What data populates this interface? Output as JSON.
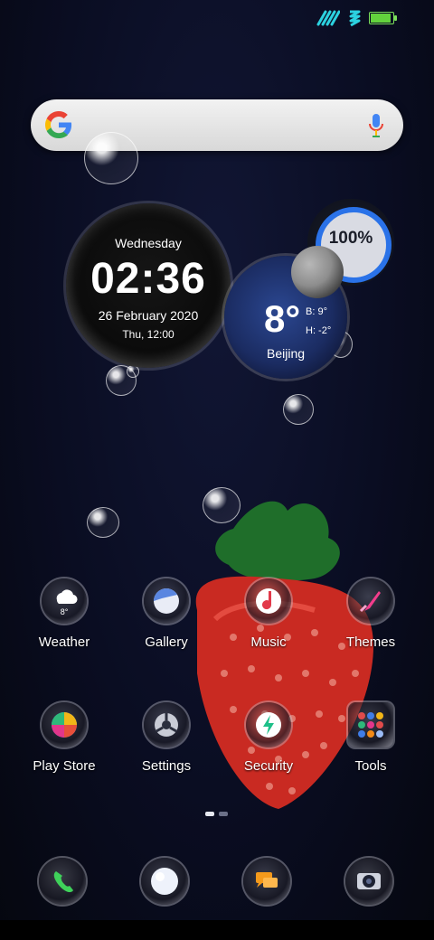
{
  "status_bar": {
    "icons": [
      "signal-icon",
      "network-icon",
      "battery-icon"
    ],
    "battery_level": 1.0,
    "accent_color": "#2cd2e0",
    "battery_color": "#63d33d"
  },
  "search": {
    "logo": "G",
    "icon_left": "google-icon",
    "icon_right": "microphone-icon"
  },
  "clock_widget": {
    "day": "Wednesday",
    "time": "02:36",
    "date": "26 February 2020",
    "alarm": "Thu, 12:00"
  },
  "weather_widget": {
    "temp": "8°",
    "high": "B: 9°",
    "low": "H: -2°",
    "city": "Beijing",
    "icon": "moon-icon"
  },
  "battery_widget": {
    "percent_text": "100%",
    "level": 1.0,
    "ring_color": "#2a72e8"
  },
  "apps": [
    {
      "label": "Weather",
      "icon": "weather-icon",
      "sub": "8°"
    },
    {
      "label": "Gallery",
      "icon": "gallery-icon"
    },
    {
      "label": "Music",
      "icon": "music-icon"
    },
    {
      "label": "Themes",
      "icon": "themes-icon"
    },
    {
      "label": "Play Store",
      "icon": "play-store-icon"
    },
    {
      "label": "Settings",
      "icon": "settings-icon"
    },
    {
      "label": "Security",
      "icon": "security-icon"
    },
    {
      "label": "Tools",
      "icon": "tools-icon"
    }
  ],
  "pager": {
    "pages": 2,
    "current": 1
  },
  "dock": [
    {
      "icon": "phone-icon"
    },
    {
      "icon": "messages-bubble-icon"
    },
    {
      "icon": "chat-icon"
    },
    {
      "icon": "camera-icon"
    }
  ]
}
